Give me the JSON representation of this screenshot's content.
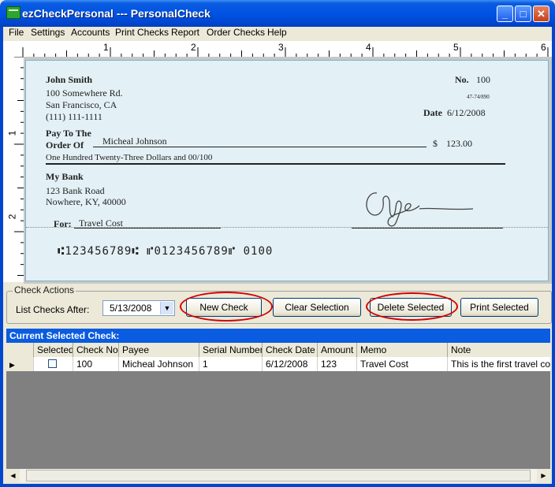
{
  "window": {
    "title": "ezCheckPersonal --- PersonalCheck",
    "controls": {
      "minimize": "_",
      "maximize": "□",
      "close": "✕"
    }
  },
  "menu": [
    "File",
    "Settings",
    "Accounts",
    "Print Checks",
    "Report",
    "Order Checks",
    "Help"
  ],
  "ruler": {
    "top_numbers": [
      "1",
      "2",
      "3",
      "4",
      "5",
      "6"
    ],
    "left_numbers": [
      "1",
      "2"
    ]
  },
  "check": {
    "payer_name": "John Smith",
    "address1": "100 Somewhere Rd.",
    "address2": "San Francisco, CA",
    "phone": "(111) 111-1111",
    "no_label": "No.",
    "number": "100",
    "fraction": "47-74/890",
    "date_label": "Date",
    "date": "6/12/2008",
    "pay_to_label1": "Pay To The",
    "pay_to_label2": "Order Of",
    "payee": "Micheal Johnson",
    "currency": "$",
    "amount": "123.00",
    "amount_words": "One Hundred Twenty-Three Dollars and 00/100",
    "bank_name": "My Bank",
    "bank_address1": "123 Bank Road",
    "bank_address2": "Nowhere, KY, 40000",
    "for_label": "For:",
    "memo": "Travel Cost",
    "micr": "⑆123456789⑆  ⑈0123456789⑈   0100"
  },
  "actions": {
    "legend": "Check Actions",
    "list_after_label": "List Checks After:",
    "list_after_value": "5/13/2008",
    "buttons": {
      "new_check": "New Check",
      "clear_selection": "Clear Selection",
      "delete_selected": "Delete Selected",
      "print_selected": "Print Selected"
    }
  },
  "grid": {
    "title": "Current Selected Check:",
    "columns": [
      "Selected",
      "Check No",
      "Payee",
      "Serial Number",
      "Check Date",
      "Amount",
      "Memo",
      "Note"
    ],
    "rows": [
      {
        "selected": false,
        "check_no": "100",
        "payee": "Micheal Johnson",
        "serial": "1",
        "date": "6/12/2008",
        "amount": "123",
        "memo": "Travel Cost",
        "note": "This is the first travel cost p"
      }
    ]
  },
  "colors": {
    "titlebar": "#0053e3",
    "check_bg": "#e3f0f5",
    "highlight": "#d40000",
    "grid_title": "#0a5ce0"
  }
}
